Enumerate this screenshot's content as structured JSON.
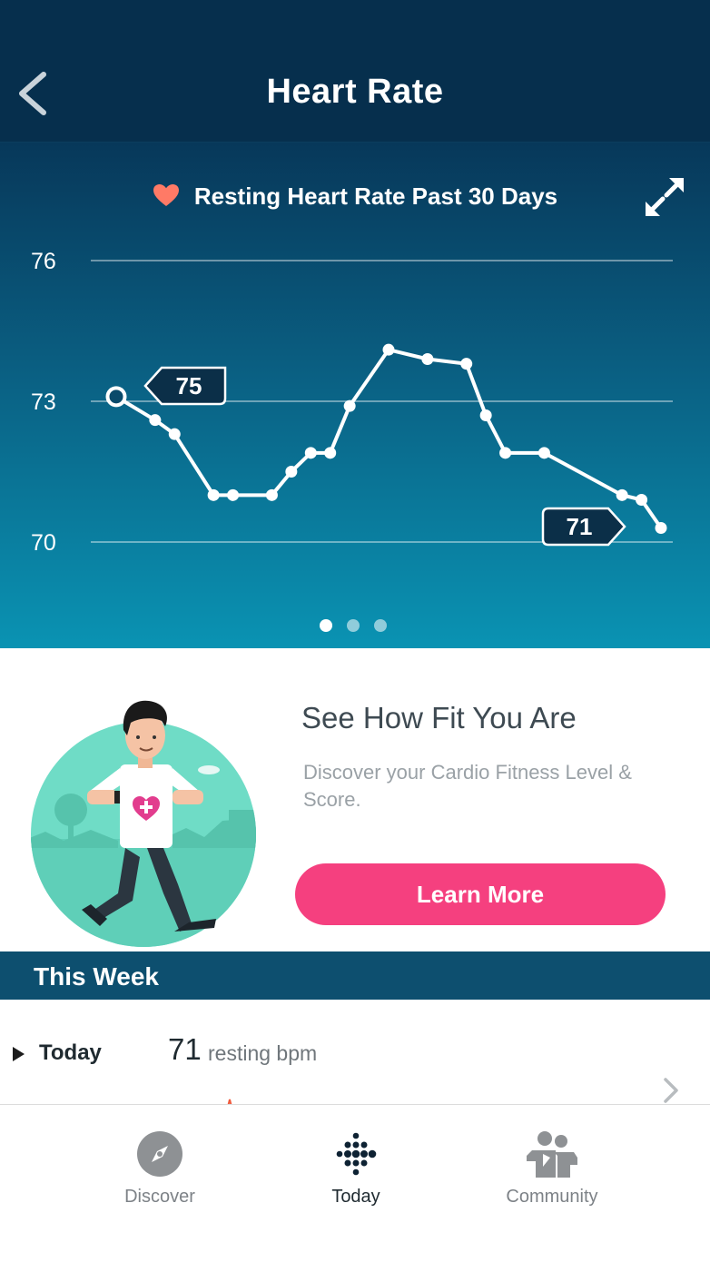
{
  "header": {
    "title": "Heart Rate",
    "back_icon": "chevron-left-icon"
  },
  "chart": {
    "heading": "Resting Heart Rate Past 30 Days",
    "heading_icon": "heart-icon",
    "heading_icon_color": "#ff7a66",
    "expand_icon": "expand-arrows-icon",
    "page_dots": {
      "count": 3,
      "active_index": 0
    }
  },
  "chart_data": {
    "type": "line",
    "ylabel": "",
    "xlabel": "",
    "yticks": [
      70,
      73,
      76
    ],
    "ylim": [
      70,
      76
    ],
    "x": [
      1,
      3,
      4,
      6,
      7,
      9,
      10,
      11,
      12,
      13,
      15,
      17,
      19,
      20,
      21,
      23,
      27,
      28,
      29
    ],
    "values": [
      73.1,
      72.6,
      72.3,
      71.0,
      71.0,
      71.0,
      71.5,
      71.9,
      71.9,
      72.9,
      74.1,
      73.9,
      73.8,
      72.7,
      71.9,
      71.9,
      71.0,
      70.9,
      70.3
    ],
    "callouts": [
      {
        "label": "75",
        "point_index": 0
      },
      {
        "label": "71",
        "point_index": 18
      }
    ],
    "grid": true,
    "line_color": "#ffffff"
  },
  "promo": {
    "title": "See How Fit You Are",
    "description": "Discover your Cardio Fitness Level & Score.",
    "button_label": "Learn More",
    "button_color": "#f5407f",
    "illustration": "runner-illustration"
  },
  "this_week": {
    "heading": "This Week",
    "today": {
      "label": "Today",
      "value": "71",
      "unit": "resting bpm"
    }
  },
  "bottom_nav": {
    "items": [
      {
        "label": "Discover",
        "icon": "compass-icon"
      },
      {
        "label": "Today",
        "icon": "fitbit-dots-icon",
        "active": true
      },
      {
        "label": "Community",
        "icon": "community-icon"
      }
    ]
  }
}
